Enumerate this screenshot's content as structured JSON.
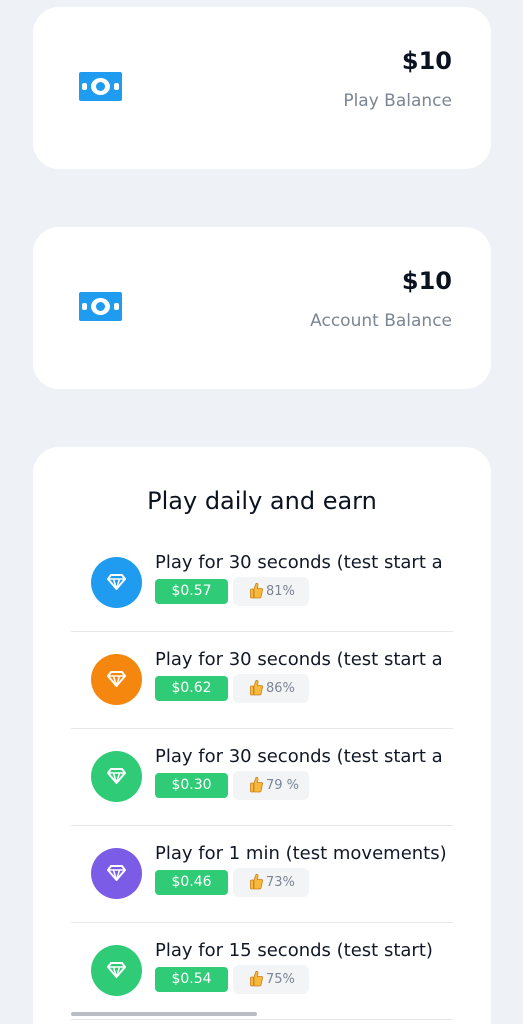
{
  "balances": [
    {
      "amount": "$10",
      "label": "Play Balance",
      "icon": "money-bill-icon"
    },
    {
      "amount": "$10",
      "label": "Account Balance",
      "icon": "money-bill-icon"
    }
  ],
  "earn": {
    "title": "Play daily and earn",
    "tasks": [
      {
        "title": "Play for 30 seconds (test start a",
        "reward": "$0.57",
        "rating": "81%",
        "color": "#1f9bf0",
        "icon": "diamond-icon"
      },
      {
        "title": "Play for 30 seconds (test start a",
        "reward": "$0.62",
        "rating": "86%",
        "color": "#f5870f",
        "icon": "diamond-icon"
      },
      {
        "title": "Play for 30 seconds (test start a",
        "reward": "$0.30",
        "rating": "79 %",
        "color": "#2fcb77",
        "icon": "diamond-icon"
      },
      {
        "title": "Play for 1 min (test movements)",
        "reward": "$0.46",
        "rating": "73%",
        "color": "#7b5ce6",
        "icon": "diamond-icon"
      },
      {
        "title": "Play for 15 seconds (test start)",
        "reward": "$0.54",
        "rating": "75%",
        "color": "#2fcb77",
        "icon": "diamond-icon"
      }
    ]
  },
  "colors": {
    "background": "#eef2f6",
    "reward_green": "#2fcb77",
    "bill_blue": "#1f9bf0"
  }
}
